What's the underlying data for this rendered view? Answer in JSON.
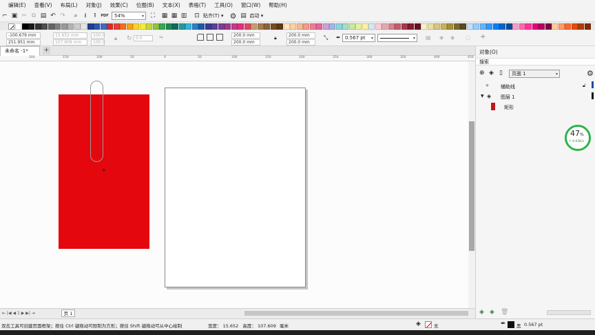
{
  "menu": [
    "编辑(E)",
    "查看(V)",
    "布局(L)",
    "对象(J)",
    "效果(C)",
    "位图(B)",
    "文本(X)",
    "表格(T)",
    "工具(O)",
    "窗口(W)",
    "帮助(H)"
  ],
  "toolbar": {
    "zoom": "54%",
    "snap_label": "贴齐(T)",
    "launch_label": "启动",
    "pdf_label": "PDF"
  },
  "palette_colors": [
    "#ffffff",
    "#000000",
    "#1a1a1a",
    "#333333",
    "#4d4d4d",
    "#666666",
    "#808080",
    "#999999",
    "#b3b3b3",
    "#cccccc",
    "#e6e6e6",
    "#1d3f8f",
    "#2b57a8",
    "#3a6fc4",
    "#d92b2b",
    "#e3413c",
    "#f2701c",
    "#f7a21b",
    "#fdd32b",
    "#f5ec3a",
    "#c3d936",
    "#8cc63f",
    "#36a852",
    "#1e8a4c",
    "#0e6b5c",
    "#1f9ba0",
    "#37b4d8",
    "#2683c6",
    "#1f5aa6",
    "#3b3b94",
    "#5b3f99",
    "#7c3d96",
    "#a13a8f",
    "#c7378c",
    "#e2307d",
    "#e6436a",
    "#c69c6d",
    "#a67c52",
    "#8c6239",
    "#754c24",
    "#603913",
    "#ffe6cc",
    "#ffd0a0",
    "#f9b990",
    "#f49b88",
    "#f07c8f",
    "#e8669c",
    "#c9a0dc",
    "#a1b7e0",
    "#8fd3e8",
    "#9fe0c7",
    "#c7e9a0",
    "#e9f1a0",
    "#fff2a0",
    "#d4e8f7",
    "#ffccd5",
    "#e6a8b3",
    "#d6828f",
    "#c45c6d",
    "#a9384a",
    "#871a2c",
    "#6d0f1f",
    "#f7f1d0",
    "#e9dfa8",
    "#d9c87e",
    "#c8b358",
    "#a68e3a",
    "#7d6a2a",
    "#5a4b1c",
    "#c0e0ff",
    "#99ccff",
    "#66b3ff",
    "#3399ff",
    "#0080ff",
    "#0066cc",
    "#004d99",
    "#ff99cc",
    "#ff66b2",
    "#ff3399",
    "#e6007e",
    "#b30062",
    "#800046",
    "#ffcc99",
    "#ff9966",
    "#ff6633",
    "#e64d00",
    "#b33c00",
    "#802b00"
  ],
  "props": {
    "x": "-100.679 mm",
    "y": "251.951 mm",
    "w": "15.652 mm",
    "h": "107.609 mm",
    "sx": "100.0",
    "sy": "100.0",
    "angle": "0.0",
    "r1": "200.0 mm",
    "r2": "200.0 mm",
    "r3": "200.0 mm",
    "r4": "200.0 mm",
    "outline": "0.567 pt"
  },
  "document_tab": "未命名 -1*",
  "ruler_labels": [
    "200",
    "150",
    "100",
    "50",
    "0",
    "50",
    "100",
    "150",
    "200",
    "250",
    "300",
    "350",
    "400",
    "450"
  ],
  "page_tab": "页 1",
  "panel": {
    "title": "对象(O)",
    "search": "搜索",
    "page_name": "页面 1",
    "guides": "辅助线",
    "layer": "图层 1",
    "object": "矩形"
  },
  "badge": {
    "percent": "47",
    "unit": "%",
    "speed": "↑ 0.03K/s"
  },
  "status": {
    "hint": "双击工具可创建页面框架；按住 Ctrl 键拖动可限制为方形；按住 Shift 键拖动可从中心绘制",
    "width_label": "宽度：",
    "width_val": "15.652",
    "height_label": "高度：",
    "height_val": "107.609",
    "unit": "毫米",
    "fill_none": "无",
    "outline_color": "黑",
    "outline_width": "0.567 pt"
  },
  "colors": {
    "rect_fill": "#e4080e",
    "badge_ring": "#2ab34a"
  }
}
